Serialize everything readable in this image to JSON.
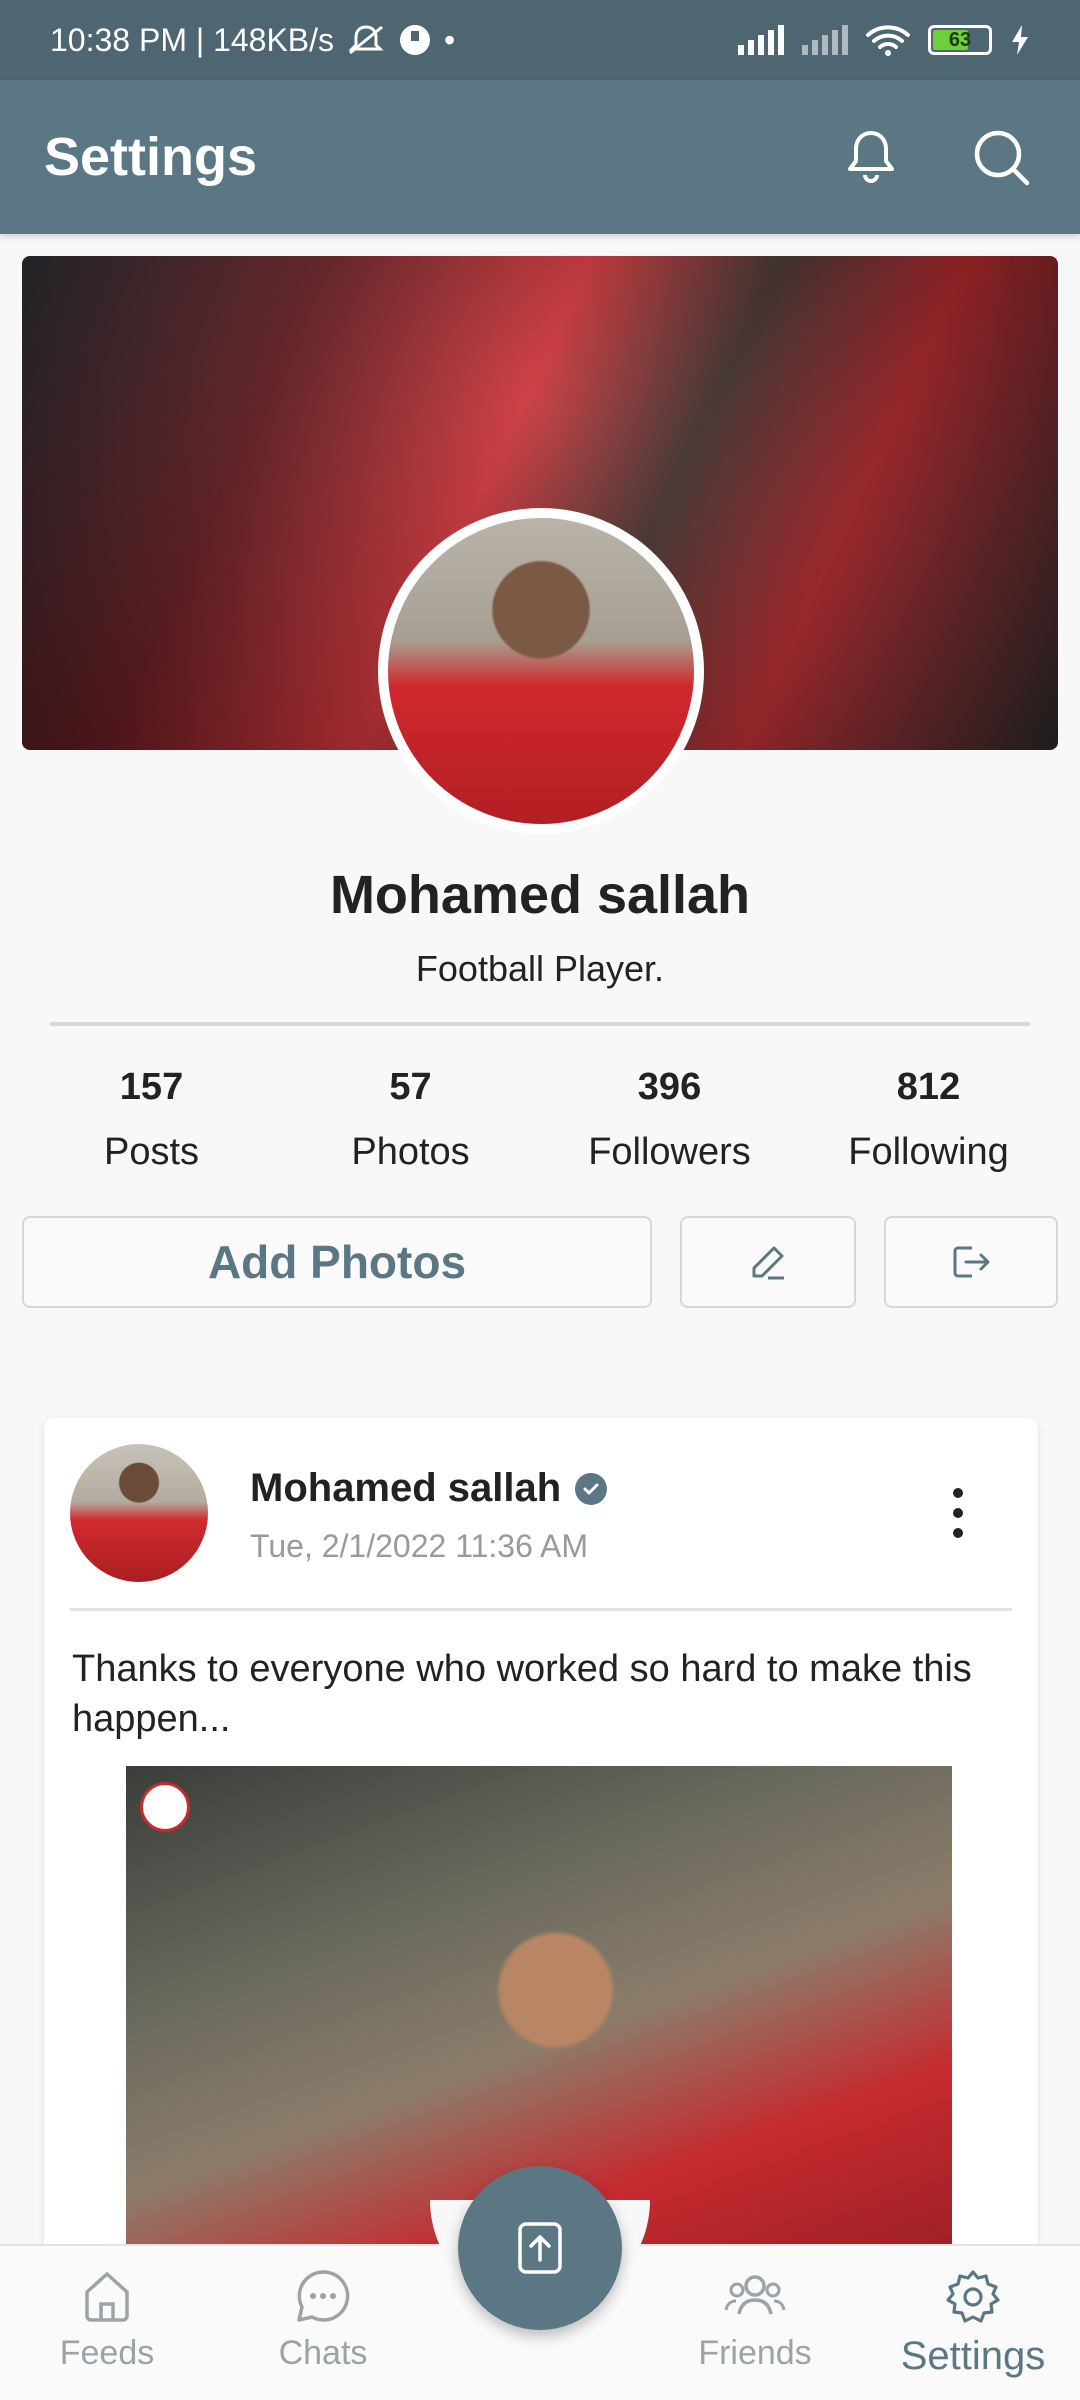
{
  "status_bar": {
    "time_speed": "10:38 PM | 148KB/s",
    "battery_level": "63"
  },
  "app_bar": {
    "title": "Settings",
    "actions": [
      "bell-icon",
      "search-icon"
    ]
  },
  "profile": {
    "name": "Mohamed sallah",
    "bio": "Football Player.",
    "stats": [
      {
        "value": "157",
        "label": "Posts"
      },
      {
        "value": "57",
        "label": "Photos"
      },
      {
        "value": "396",
        "label": "Followers"
      },
      {
        "value": "812",
        "label": "Following"
      }
    ],
    "add_photos_label": "Add Photos"
  },
  "post": {
    "author": "Mohamed sallah",
    "timestamp": "Tue, 2/1/2022 11:36 AM",
    "text": "Thanks to everyone who worked so hard to make this happen..."
  },
  "bottom_nav": {
    "items": [
      {
        "label": "Feeds",
        "icon": "home-icon"
      },
      {
        "label": "Chats",
        "icon": "chat-icon"
      },
      {
        "label": "Friends",
        "icon": "friends-icon"
      },
      {
        "label": "Settings",
        "icon": "gear-icon"
      }
    ],
    "active": "Settings"
  },
  "colors": {
    "primary": "#5b7784",
    "status_bar": "#4e6672",
    "background": "#f8f8f8"
  }
}
